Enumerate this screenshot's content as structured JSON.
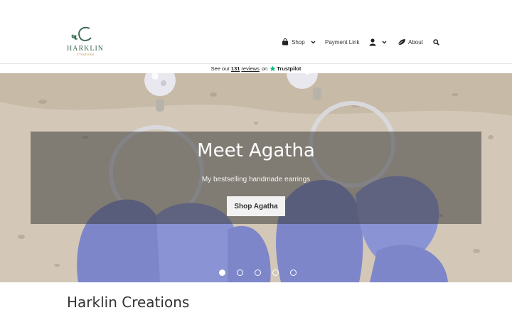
{
  "header": {
    "logo": {
      "name": "HARKLIN",
      "tagline": "Creations"
    },
    "nav": {
      "shop_label": "Shop",
      "payment_label": "Payment Link",
      "about_label": "About"
    }
  },
  "trustbar": {
    "prefix": "See our",
    "count": "131",
    "reviews": "reviews",
    "on": "on",
    "brand": "Trustpilot"
  },
  "hero": {
    "title": "Meet Agatha",
    "subtitle": "My bestselling handmade earrings",
    "button_label": "Shop Agatha",
    "slides": {
      "count": 5,
      "active_index": 0
    }
  },
  "main": {
    "heading": "Harklin Creations"
  },
  "colors": {
    "logo_green": "#3f6a55",
    "logo_gold": "#b79a4d",
    "trustpilot_green": "#00b67a",
    "earring_blue": "#7d86c9",
    "overlay": "rgba(60,60,60,0.55)"
  },
  "icons": [
    "bag-icon",
    "chevron-down-icon",
    "user-icon",
    "leaf-icon",
    "search-icon",
    "trustpilot-star-icon"
  ]
}
